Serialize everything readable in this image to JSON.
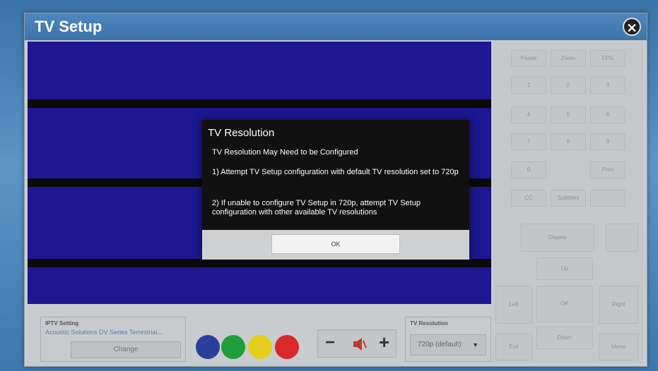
{
  "window": {
    "title": "TV Setup"
  },
  "keypad": {
    "pause": "Pause",
    "zoom": "Zoom",
    "epg": "EPG",
    "k1": "1",
    "k2": "2",
    "k3": "3",
    "k4": "4",
    "k5": "5",
    "k6": "6",
    "k7": "7",
    "k8": "8",
    "k9": "9",
    "k0": "0",
    "prev": "Prev",
    "cc": "CC",
    "subtitles": "Subtitles",
    "dash": "-",
    "display": "Display",
    "up": "Up",
    "left": "Left",
    "ok": "OK",
    "right": "Right",
    "down": "Down",
    "exit": "Exit",
    "menu": "Menu"
  },
  "iptv": {
    "label": "IPTV Setting",
    "value": "Acoustic Solutions DV Series Terrestrial...",
    "change": "Change"
  },
  "color_buttons": [
    {
      "name": "blue",
      "color": "#2a3f9a"
    },
    {
      "name": "green",
      "color": "#1e9e3a"
    },
    {
      "name": "yellow",
      "color": "#e3cf1a"
    },
    {
      "name": "red",
      "color": "#d9272a"
    }
  ],
  "volume": {
    "minus": "−",
    "mute_icon": "speaker-mute-icon",
    "plus": "+"
  },
  "resolution": {
    "label": "TV Resolution",
    "selected": "720p (default)"
  },
  "dialog": {
    "title": "TV Resolution",
    "line1": "TV Resolution May Need to be Configured",
    "line2": "1) Attempt TV Setup configuration with default TV resolution set to 720p",
    "line3": "2) If unable to configure TV Setup in 720p, attempt TV Setup configuration with other available TV resolutions",
    "ok": "OK"
  }
}
